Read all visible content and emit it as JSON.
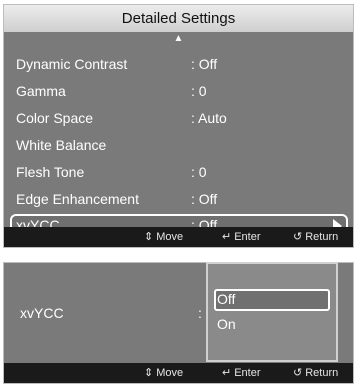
{
  "menu": {
    "title": "Detailed Settings",
    "rows": [
      {
        "label": "Dynamic Contrast",
        "value": ": Off"
      },
      {
        "label": "Gamma",
        "value": ": 0"
      },
      {
        "label": "Color Space",
        "value": ": Auto"
      },
      {
        "label": "White Balance",
        "value": ""
      },
      {
        "label": "Flesh Tone",
        "value": ": 0"
      },
      {
        "label": "Edge Enhancement",
        "value": ": Off"
      },
      {
        "label": "xvYCC",
        "value": ": Off"
      }
    ]
  },
  "footer": {
    "move": "Move",
    "enter": "Enter",
    "return": "Return"
  },
  "submenu": {
    "label": "xvYCC",
    "colon": ":",
    "options": [
      "Off",
      "On"
    ],
    "selected": "Off"
  },
  "colors": {
    "panel_bg": "#7a7a7a",
    "titlebar": "#e0e0e0",
    "footer_bg": "#1a1a1a",
    "highlight_border": "#ffffff"
  },
  "icons": {
    "up_arrow": "triangle-up-icon",
    "right_arrow": "triangle-right-icon",
    "move": "updown-arrow-icon",
    "enter": "enter-icon",
    "return": "return-icon"
  }
}
